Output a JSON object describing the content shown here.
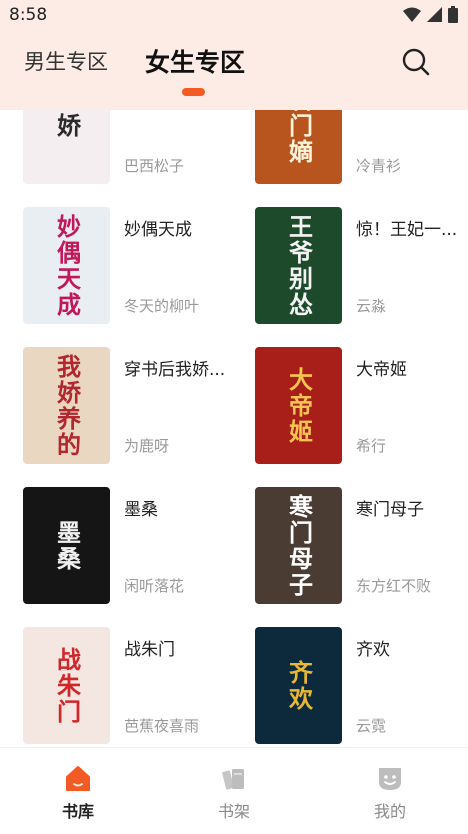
{
  "status_bar": {
    "time": "8:58"
  },
  "tabs": {
    "male": "男生专区",
    "female": "女生专区",
    "active": "female"
  },
  "books": [
    {
      "title": "",
      "author": "巴西松子",
      "cover_text": "娇",
      "cover_bg": "#f5eef0",
      "cover_fg": "#2a2a2a"
    },
    {
      "title": "",
      "author": "冷青衫",
      "cover_text": "名门嫡",
      "cover_bg": "#b8551e",
      "cover_fg": "#fff4dc"
    },
    {
      "title": "妙偶天成",
      "author": "冬天的柳叶",
      "cover_text": "妙偶天成",
      "cover_bg": "#e9eef2",
      "cover_fg": "#c2185b"
    },
    {
      "title": "惊！王妃一...",
      "author": "云淼",
      "cover_text": "王爷别怂",
      "cover_bg": "#1e4a2c",
      "cover_fg": "#f3f3f3"
    },
    {
      "title": "穿书后我娇...",
      "author": "为鹿呀",
      "cover_text": "我娇养的",
      "cover_bg": "#ead7c2",
      "cover_fg": "#b3262e"
    },
    {
      "title": "大帝姬",
      "author": "希行",
      "cover_text": "大帝姬",
      "cover_bg": "#a81f1a",
      "cover_fg": "#f6c451"
    },
    {
      "title": "墨桑",
      "author": "闲听落花",
      "cover_text": "墨桑",
      "cover_bg": "#151515",
      "cover_fg": "#f0f0f0"
    },
    {
      "title": "寒门母子",
      "author": "东方红不败",
      "cover_text": "寒门母子",
      "cover_bg": "#4a3b33",
      "cover_fg": "#ffffff"
    },
    {
      "title": "战朱门",
      "author": "芭蕉夜喜雨",
      "cover_text": "战朱门",
      "cover_bg": "#f4e7e1",
      "cover_fg": "#d1262a"
    },
    {
      "title": "齐欢",
      "author": "云霓",
      "cover_text": "齐欢",
      "cover_bg": "#0d2a3d",
      "cover_fg": "#e8b736"
    }
  ],
  "nav": [
    {
      "label": "书库",
      "icon": "bookstore-icon",
      "active": true
    },
    {
      "label": "书架",
      "icon": "bookshelf-icon",
      "active": false
    },
    {
      "label": "我的",
      "icon": "profile-icon",
      "active": false
    }
  ],
  "colors": {
    "accent": "#f45b24",
    "header_bg": "#fdece6"
  }
}
